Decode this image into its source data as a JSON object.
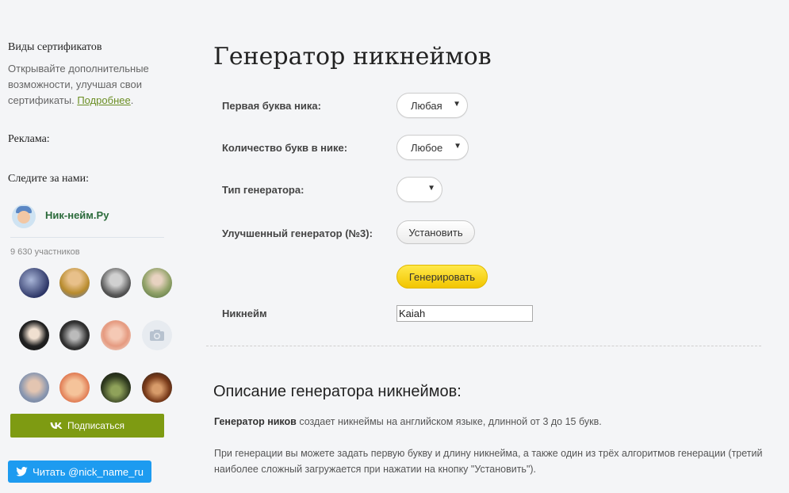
{
  "sidebar": {
    "cert_title": "Виды сертификатов",
    "cert_text": "Открывайте дополнительные возможности, улучшая свои сертификаты.",
    "cert_link": "Подробнее",
    "cert_after": ".",
    "ads_title": "Реклама:",
    "follow_title": "Следите за нами:",
    "vk": {
      "group_name": "Ник-нейм.Ру",
      "members": "9 630 участников",
      "subscribe_label": "Подписаться"
    },
    "twitter_label": "Читать @nick_name_ru"
  },
  "main": {
    "title": "Генератор никнеймов",
    "form": {
      "first_letter_label": "Первая буква ника:",
      "first_letter_value": "Любая",
      "letter_count_label": "Количество букв в нике:",
      "letter_count_value": "Любое",
      "generator_type_label": "Тип генератора:",
      "generator_type_value": "",
      "improved_label": "Улучшенный генератор (№3):",
      "install_label": "Установить",
      "generate_label": "Генерировать",
      "nickname_label": "Никнейм",
      "nickname_value": "Kaiah"
    },
    "description": {
      "title": "Описание генератора никнеймов:",
      "p1_bold": "Генератор ников",
      "p1_rest": " создает никнеймы на английском языке, длинной от 3 до 15 букв.",
      "p2": "При генерации вы можете задать первую букву и длину никнейма, а также один из трёх алгоритмов генерации (третий наиболее сложный загружается при нажатии на кнопку \"Установить\")."
    }
  },
  "colors": {
    "vk_button": "#7e9b12",
    "twitter_button": "#1d9bf0",
    "generate_button": "#f2c500",
    "link": "#6b8e23"
  }
}
